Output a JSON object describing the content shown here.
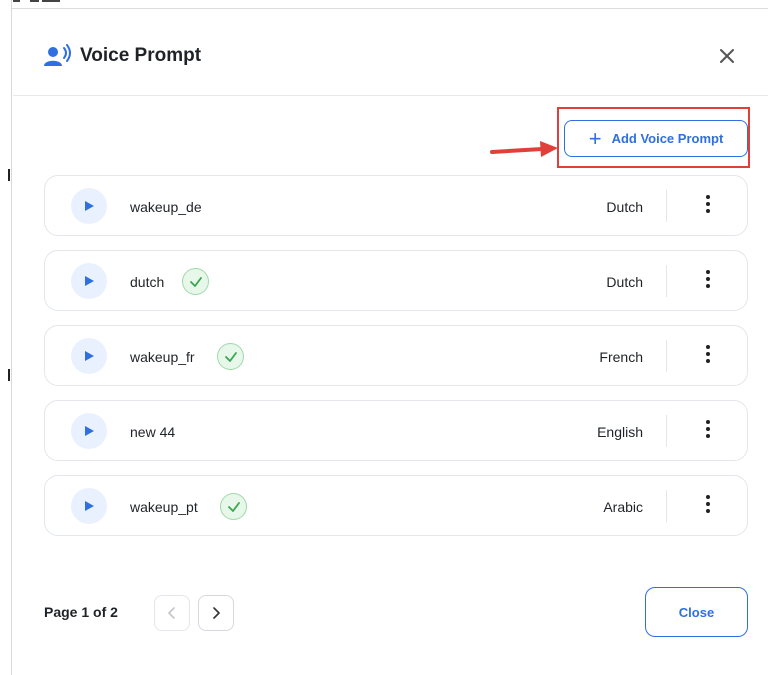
{
  "dialog": {
    "title": "Voice Prompt",
    "header_icon": "voice-user-icon",
    "close_icon": "close-icon"
  },
  "toolbar": {
    "add_label": "Add Voice Prompt",
    "add_icon": "plus-icon"
  },
  "prompts": [
    {
      "name": "wakeup_de",
      "language": "Dutch",
      "verified": false
    },
    {
      "name": "dutch",
      "language": "Dutch",
      "verified": true
    },
    {
      "name": "wakeup_fr",
      "language": "French",
      "verified": true
    },
    {
      "name": "new 44",
      "language": "English",
      "verified": false
    },
    {
      "name": "wakeup_pt",
      "language": "Arabic",
      "verified": true
    }
  ],
  "pagination": {
    "label": "Page 1 of 2"
  },
  "footer": {
    "close_label": "Close"
  },
  "colors": {
    "accent": "#2f6fe0",
    "highlight": "#e0403a",
    "check_green": "#3aa64f"
  }
}
